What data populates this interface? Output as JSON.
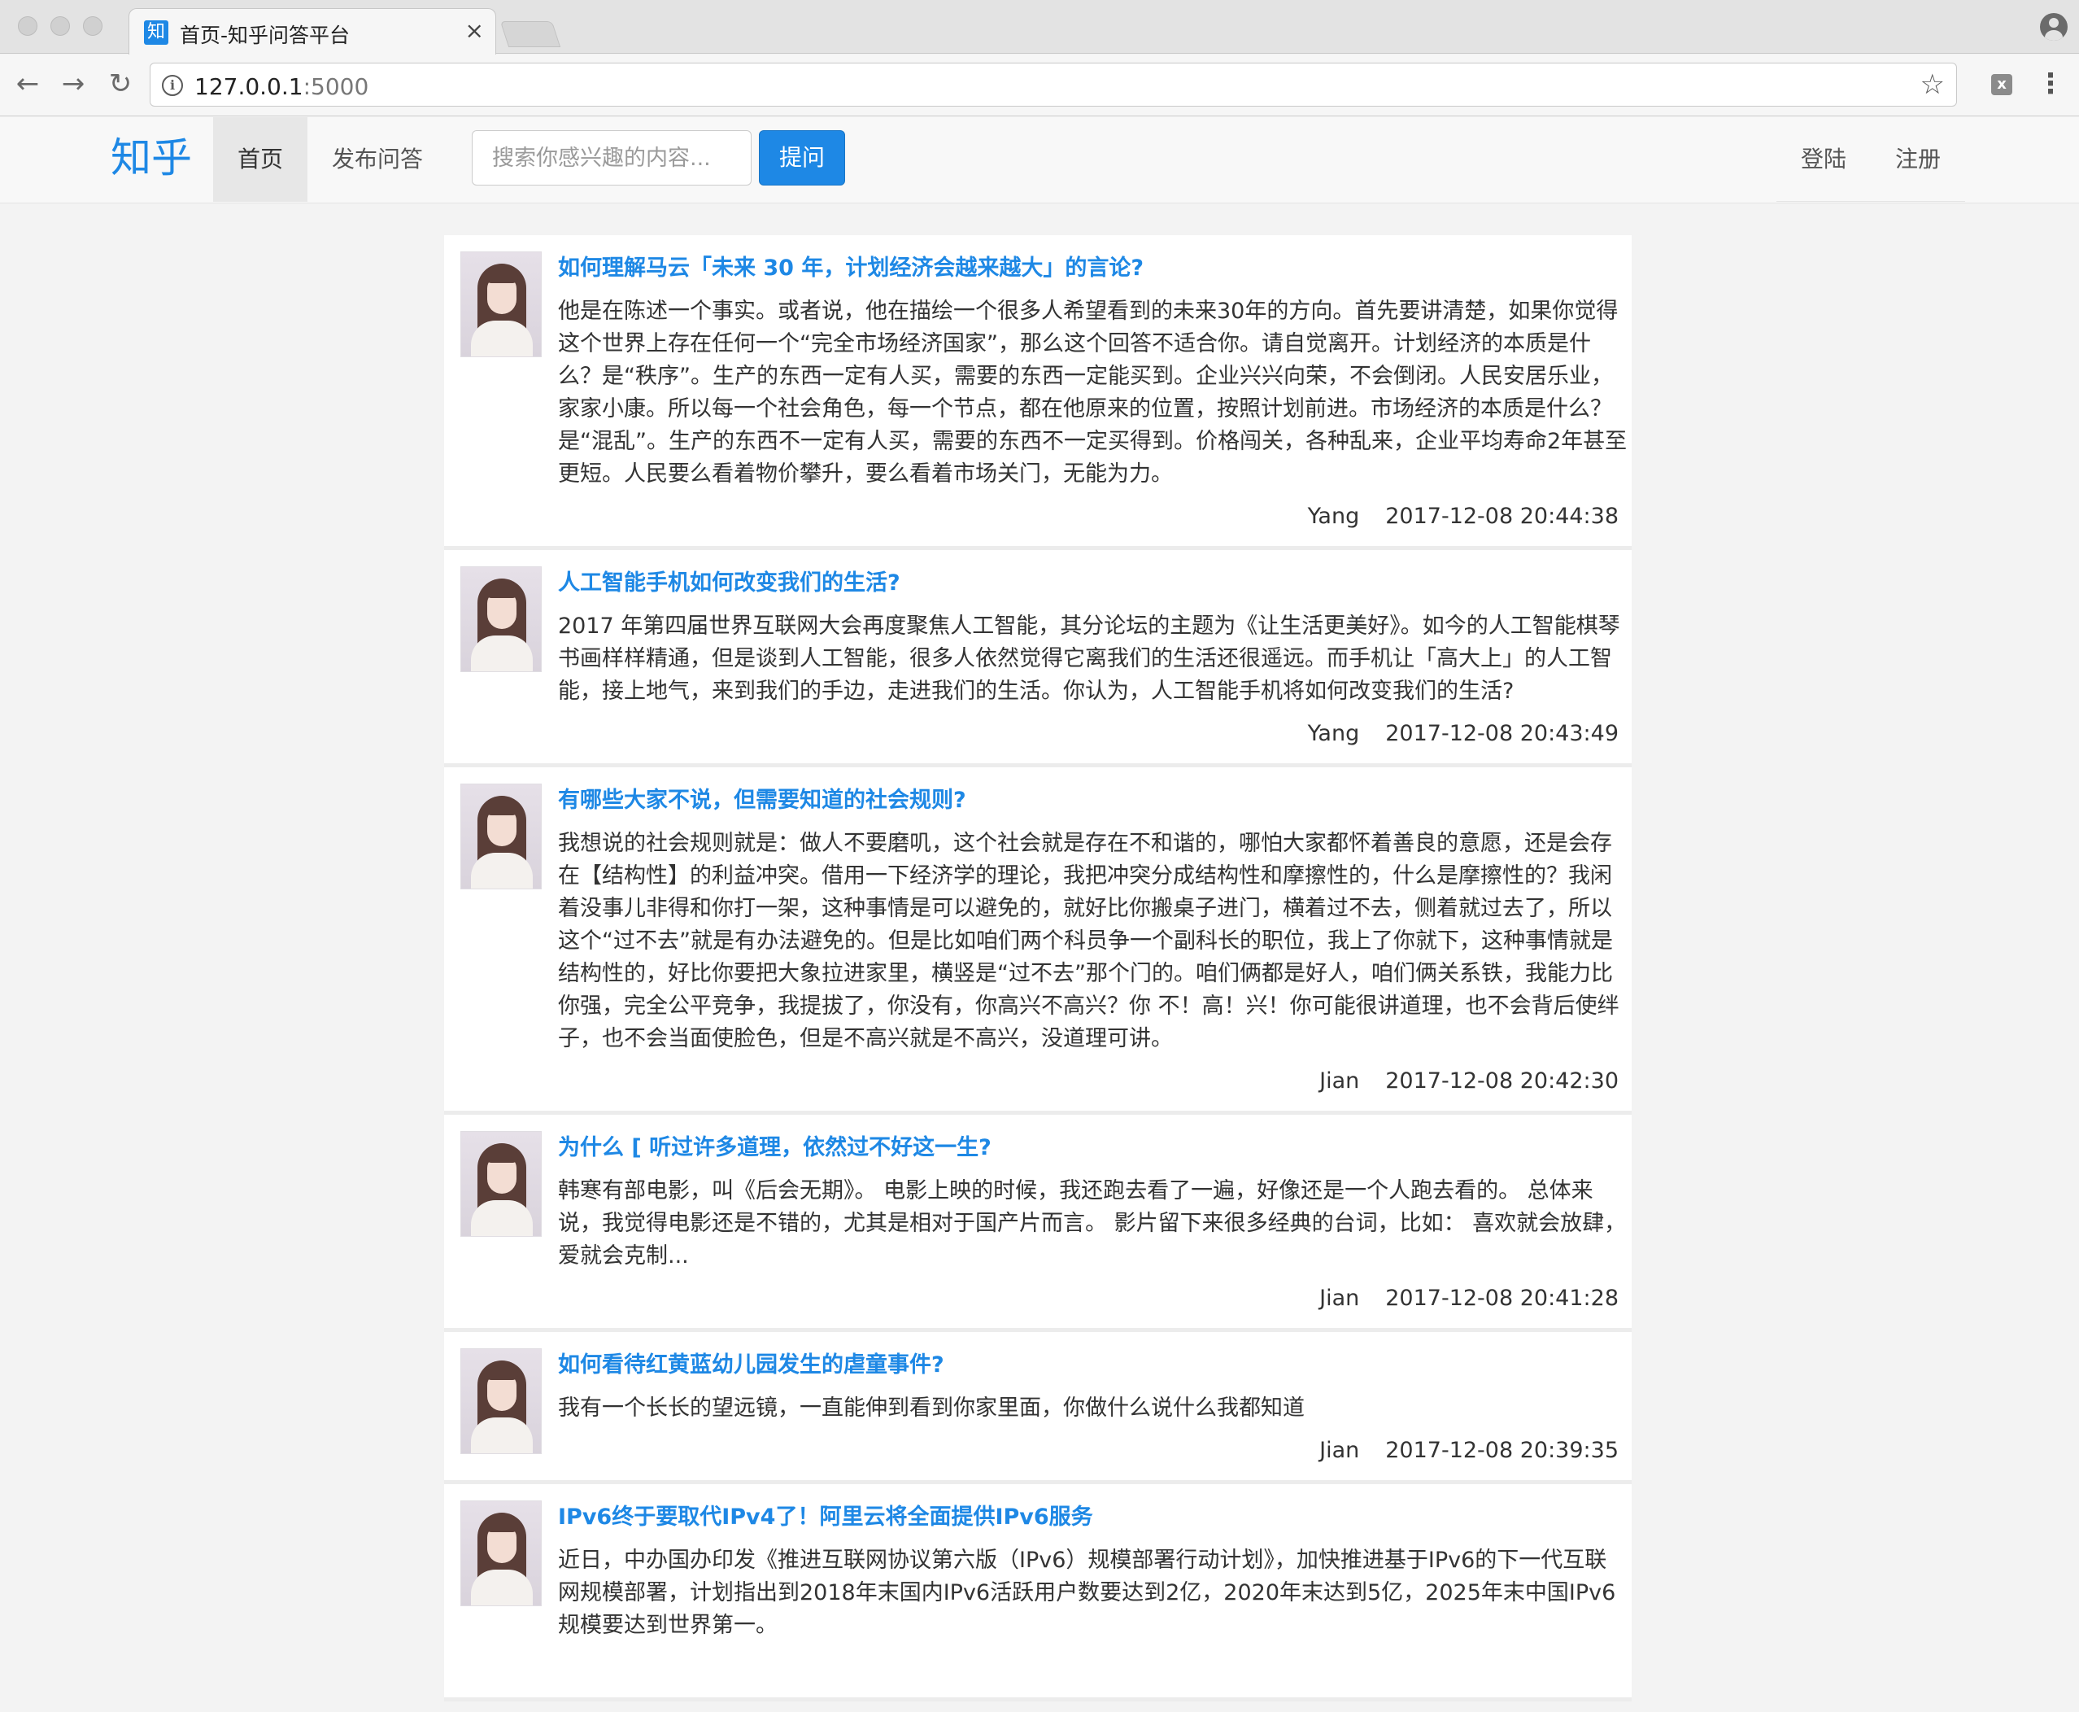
{
  "browser": {
    "tab_title": "首页-知乎问答平台",
    "tab_favicon": "知",
    "tab_close": "×",
    "url_host": "127.0.0.1",
    "url_port": ":5000",
    "ext_label": "x"
  },
  "site": {
    "brand": "知乎",
    "nav_home": "首页",
    "nav_publish": "发布问答",
    "search_placeholder": "搜索你感兴趣的内容...",
    "ask_button": "提问",
    "login": "登陆",
    "register": "注册"
  },
  "questions": [
    {
      "title": "如何理解马云「未来 30 年，计划经济会越来越大」的言论?",
      "body": "他是在陈述一个事实。或者说，他在描绘一个很多人希望看到的未来30年的方向。首先要讲清楚，如果你觉得这个世界上存在任何一个“完全市场经济国家”，那么这个回答不适合你。请自觉离开。计划经济的本质是什么？是“秩序”。生产的东西一定有人买，需要的东西一定能买到。企业兴兴向荣，不会倒闭。人民安居乐业，家家小康。所以每一个社会角色，每一个节点，都在他原来的位置，按照计划前进。市场经济的本质是什么？是“混乱”。生产的东西不一定有人买，需要的东西不一定买得到。价格闯关，各种乱来，企业平均寿命2年甚至更短。人民要么看着物价攀升，要么看着市场关门，无能为力。",
      "author": "Yang",
      "time": "2017-12-08 20:44:38"
    },
    {
      "title": "人工智能手机如何改变我们的生活?",
      "body": "2017 年第四届世界互联网大会再度聚焦人工智能，其分论坛的主题为《让生活更美好》。如今的人工智能棋琴书画样样精通，但是谈到人工智能，很多人依然觉得它离我们的生活还很遥远。而手机让「高大上」的人工智能，接上地气，来到我们的手边，走进我们的生活。你认为，人工智能手机将如何改变我们的生活?",
      "author": "Yang",
      "time": "2017-12-08 20:43:49"
    },
    {
      "title": "有哪些大家不说，但需要知道的社会规则?",
      "body": "我想说的社会规则就是：做人不要磨叽，这个社会就是存在不和谐的，哪怕大家都怀着善良的意愿，还是会存在【结构性】的利益冲突。借用一下经济学的理论，我把冲突分成结构性和摩擦性的，什么是摩擦性的？我闲着没事儿非得和你打一架，这种事情是可以避免的，就好比你搬桌子进门，横着过不去，侧着就过去了，所以这个“过不去”就是有办法避免的。但是比如咱们两个科员争一个副科长的职位，我上了你就下，这种事情就是结构性的，好比你要把大象拉进家里，横竖是“过不去”那个门的。咱们俩都是好人，咱们俩关系铁，我能力比你强，完全公平竞争，我提拔了，你没有，你高兴不高兴？你 不！高！兴！你可能很讲道理，也不会背后使绊子，也不会当面使脸色，但是不高兴就是不高兴，没道理可讲。",
      "author": "Jian",
      "time": "2017-12-08 20:42:30"
    },
    {
      "title": "为什么 [ 听过许多道理，依然过不好这一生?",
      "body": "韩寒有部电影，叫《后会无期》。 电影上映的时候，我还跑去看了一遍，好像还是一个人跑去看的。 总体来说，我觉得电影还是不错的，尤其是相对于国产片而言。 影片留下来很多经典的台词，比如： 喜欢就会放肆，爱就会克制...",
      "author": "Jian",
      "time": "2017-12-08 20:41:28"
    },
    {
      "title": "如何看待红黄蓝幼儿园发生的虐童事件?",
      "body": "我有一个长长的望远镜，一直能伸到看到你家里面，你做什么说什么我都知道",
      "author": "Jian",
      "time": "2017-12-08 20:39:35"
    },
    {
      "title": "IPv6终于要取代IPv4了！阿里云将全面提供IPv6服务",
      "body": "近日，中办国办印发《推进互联网协议第六版（IPv6）规模部署行动计划》，加快推进基于IPv6的下一代互联网规模部署，计划指出到2018年末国内IPv6活跃用户数要达到2亿，2020年末达到5亿，2025年末中国IPv6规模要达到世界第一。",
      "author": "",
      "time": ""
    }
  ]
}
